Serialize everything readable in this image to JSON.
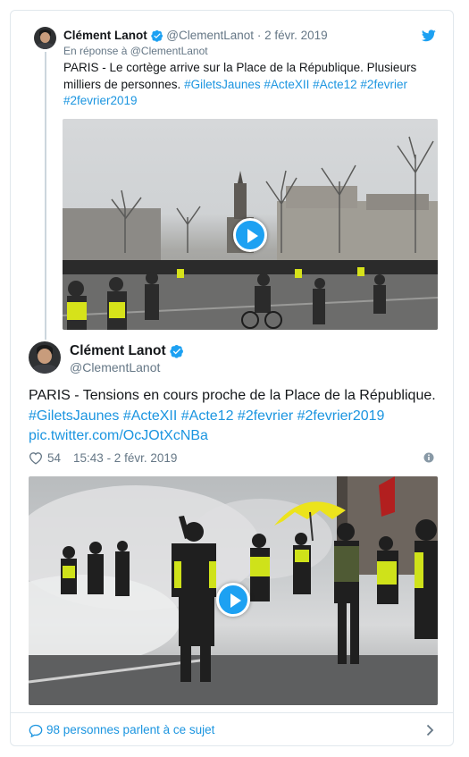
{
  "reply_tweet": {
    "author_name": "Clément Lanot",
    "handle": "@ClementLanot",
    "separator": "·",
    "date": "2 févr. 2019",
    "reply_to": "En réponse à @ClementLanot",
    "text_line1": "PARIS - Le cortège arrive sur la Place de la République. Plusieurs",
    "text_line2_plain": "milliers de personnes. ",
    "hashtags_line2": "#GiletsJaunes #ActeXII #Acte12 #2fevrier",
    "hashtags_line3": "#2fevrier2019"
  },
  "main_tweet": {
    "author_name": "Clément Lanot",
    "handle": "@ClementLanot",
    "text_line1": "PARIS - Tensions en cours proche de la Place de la République.",
    "hashtags_line2": "#GiletsJaunes #ActeXII #Acte12 #2fevrier #2fevrier2019",
    "link_line3": "pic.twitter.com/OcJOtXcNBa",
    "like_count": "54",
    "timestamp": "15:43 - 2 févr. 2019"
  },
  "footer": {
    "conversation_label": "98 personnes parlent à ce sujet"
  },
  "colors": {
    "link": "#1b95e0",
    "twitter_blue": "#1da1f2",
    "muted": "#657786"
  },
  "icons": [
    "twitter-bird-icon",
    "verified-badge-icon",
    "play-icon",
    "heart-icon",
    "info-icon",
    "speech-bubble-icon",
    "chevron-right-icon"
  ]
}
